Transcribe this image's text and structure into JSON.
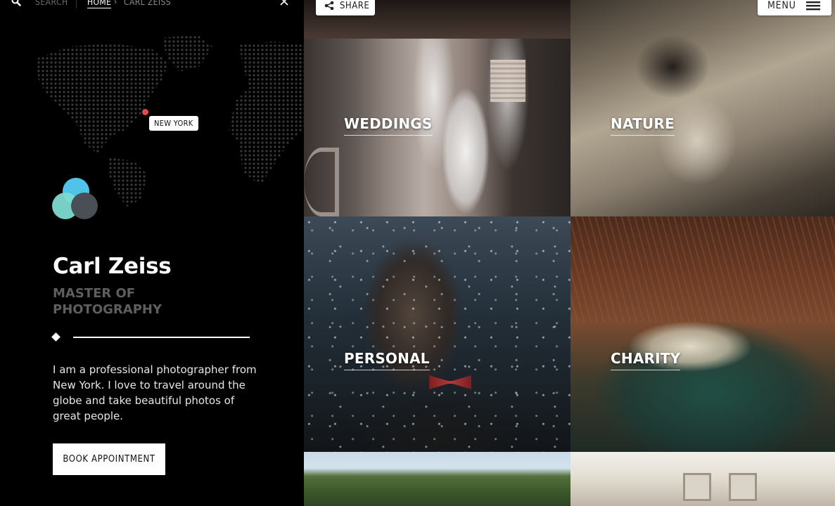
{
  "topbar": {
    "search_label": "SEARCH",
    "breadcrumb": {
      "home": "HOME",
      "separator": "›",
      "current": "CARL ZEISS"
    }
  },
  "map": {
    "location_label": "NEW YORK",
    "pin_color": "#e24a4a"
  },
  "profile": {
    "name": "Carl Zeiss",
    "title": "MASTER OF PHOTOGRAPHY",
    "bio": "I am a professional photographer from New York. I love to travel around the globe and take beautiful photos of great people.",
    "cta_label": "BOOK APPOINTMENT",
    "logo_colors": [
      "#4fc3e8",
      "#7ddad0",
      "#4a4f55"
    ]
  },
  "header": {
    "share_label": "SHARE",
    "menu_label": "MENU"
  },
  "gallery": {
    "items": [
      {
        "label": "WEDDINGS"
      },
      {
        "label": "NATURE"
      },
      {
        "label": "PERSONAL"
      },
      {
        "label": "CHARITY"
      }
    ]
  },
  "icons": {
    "search": "search-icon",
    "close": "close-icon",
    "share": "share-icon",
    "menu": "hamburger-icon",
    "pin": "map-pin-icon",
    "diamond": "diamond-icon"
  }
}
